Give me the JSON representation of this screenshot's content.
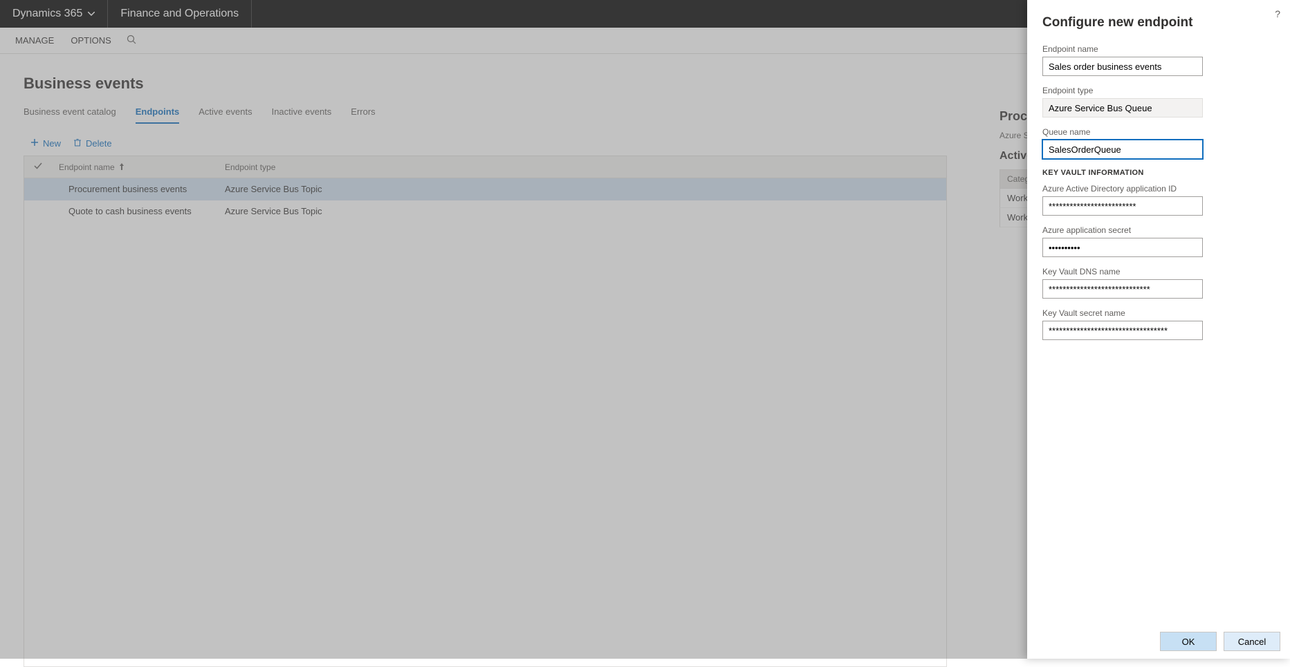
{
  "topNav": {
    "brand": "Dynamics 365",
    "appTitle": "Finance and Operations"
  },
  "actionBar": {
    "manage": "MANAGE",
    "options": "OPTIONS"
  },
  "page": {
    "title": "Business events"
  },
  "tabs": [
    {
      "label": "Business event catalog",
      "active": false
    },
    {
      "label": "Endpoints",
      "active": true
    },
    {
      "label": "Active events",
      "active": false
    },
    {
      "label": "Inactive events",
      "active": false
    },
    {
      "label": "Errors",
      "active": false
    }
  ],
  "toolbar": {
    "new": "New",
    "delete": "Delete"
  },
  "grid": {
    "columns": {
      "endpointName": "Endpoint name",
      "endpointType": "Endpoint type"
    },
    "rows": [
      {
        "name": "Procurement business events",
        "type": "Azure Service Bus Topic",
        "selected": true
      },
      {
        "name": "Quote to cash business events",
        "type": "Azure Service Bus Topic",
        "selected": false
      }
    ]
  },
  "sidePanel": {
    "heading": "Procurement bu",
    "sub": "Azure Service Bus Topic",
    "section": "Active business",
    "categoryHeader": "Category",
    "rows": [
      "Workflow",
      "Workflow"
    ]
  },
  "slideout": {
    "title": "Configure new endpoint",
    "labels": {
      "endpointName": "Endpoint name",
      "endpointType": "Endpoint type",
      "queueName": "Queue name",
      "keyVaultSection": "KEY VAULT INFORMATION",
      "aadAppId": "Azure Active Directory application ID",
      "appSecret": "Azure application secret",
      "kvDns": "Key Vault DNS name",
      "kvSecret": "Key Vault secret name"
    },
    "values": {
      "endpointName": "Sales order business events",
      "endpointType": "Azure Service Bus Queue",
      "queueName": "SalesOrderQueue",
      "aadAppId": "*************************",
      "appSecret": "••••••••••",
      "kvDns": "*****************************",
      "kvSecret": "**********************************"
    },
    "buttons": {
      "ok": "OK",
      "cancel": "Cancel"
    }
  }
}
